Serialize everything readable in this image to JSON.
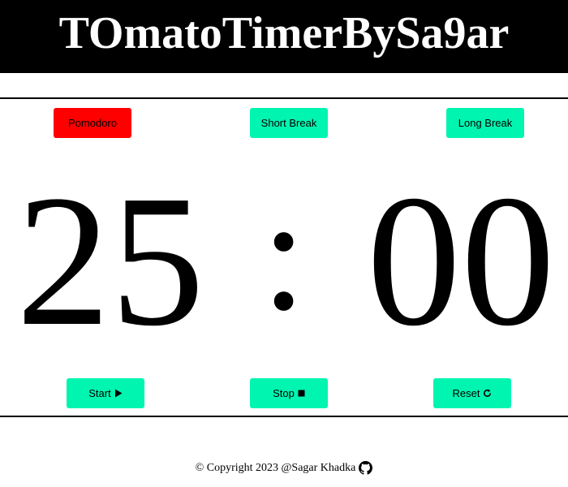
{
  "header": {
    "title": "TOmatoTimerBySa9ar"
  },
  "modes": {
    "pomodoro_label": "Pomodoro",
    "short_break_label": "Short Break",
    "long_break_label": "Long Break"
  },
  "timer": {
    "minutes": "25",
    "separator": ":",
    "seconds": "00"
  },
  "controls": {
    "start_label": "Start",
    "stop_label": "Stop",
    "reset_label": "Reset"
  },
  "footer": {
    "text": "© Copyright 2023 @Sagar Khadka"
  },
  "colors": {
    "active_mode": "#ff0000",
    "button": "#00f5b0",
    "header_bg": "#000000",
    "header_text": "#ffffff"
  },
  "icons": {
    "start": "play-icon",
    "stop": "stop-icon",
    "reset": "reset-icon",
    "footer": "github-icon"
  }
}
